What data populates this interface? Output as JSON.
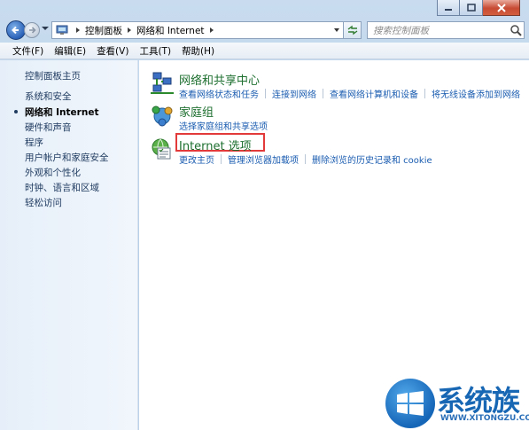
{
  "address": {
    "crumbs": [
      "控制面板",
      "网络和 Internet"
    ]
  },
  "search": {
    "placeholder": "搜索控制面板"
  },
  "menu": [
    "文件(F)",
    "编辑(E)",
    "查看(V)",
    "工具(T)",
    "帮助(H)"
  ],
  "sidebar": {
    "items": [
      {
        "label": "控制面板主页"
      },
      {
        "label": "系统和安全"
      },
      {
        "label": "网络和 Internet",
        "current": true
      },
      {
        "label": "硬件和声音"
      },
      {
        "label": "程序"
      },
      {
        "label": "用户帐户和家庭安全"
      },
      {
        "label": "外观和个性化"
      },
      {
        "label": "时钟、语言和区域"
      },
      {
        "label": "轻松访问"
      }
    ]
  },
  "categories": [
    {
      "title": "网络和共享中心",
      "icon": "network-sharing-icon",
      "links": [
        "查看网络状态和任务",
        "连接到网络",
        "查看网络计算机和设备",
        "将无线设备添加到网络"
      ]
    },
    {
      "title": "家庭组",
      "icon": "homegroup-icon",
      "links": [
        "选择家庭组和共享选项"
      ]
    },
    {
      "title": "Internet 选项",
      "icon": "internet-options-icon",
      "links": [
        "更改主页",
        "管理浏览器加载项",
        "删除浏览的历史记录和 cookie"
      ]
    }
  ],
  "watermark": {
    "brand": "系统族",
    "url": "WWW.XITONGZU.COM"
  },
  "colors": {
    "category_title": "#1d6f2f",
    "link": "#1a5cb0",
    "highlight": "#e23a3a"
  }
}
